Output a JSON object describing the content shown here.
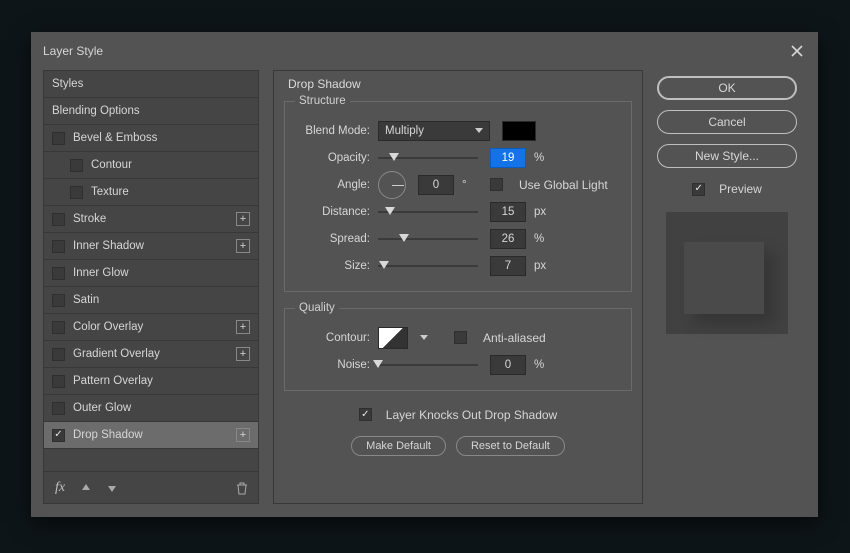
{
  "dialog": {
    "title": "Layer Style"
  },
  "styles": [
    {
      "label": "Styles",
      "type": "head"
    },
    {
      "label": "Blending Options",
      "type": "head"
    },
    {
      "label": "Bevel & Emboss",
      "chk": 1
    },
    {
      "label": "Contour",
      "chk": 1,
      "indent": 1
    },
    {
      "label": "Texture",
      "chk": 1,
      "indent": 1
    },
    {
      "label": "Stroke",
      "chk": 1,
      "plus": 1
    },
    {
      "label": "Inner Shadow",
      "chk": 1,
      "plus": 1
    },
    {
      "label": "Inner Glow",
      "chk": 1
    },
    {
      "label": "Satin",
      "chk": 1
    },
    {
      "label": "Color Overlay",
      "chk": 1,
      "plus": 1
    },
    {
      "label": "Gradient Overlay",
      "chk": 1,
      "plus": 1
    },
    {
      "label": "Pattern Overlay",
      "chk": 1
    },
    {
      "label": "Outer Glow",
      "chk": 1
    },
    {
      "label": "Drop Shadow",
      "chk": 1,
      "checked": 1,
      "active": 1,
      "plus": 1
    }
  ],
  "panel": {
    "heading": "Drop Shadow",
    "group_structure": "Structure",
    "group_quality": "Quality",
    "blend_label": "Blend Mode:",
    "blend_value": "Multiply",
    "opacity_label": "Opacity:",
    "opacity_value": "19",
    "opacity_unit": "%",
    "opacity_pos": "16%",
    "angle_label": "Angle:",
    "angle_value": "0",
    "angle_unit": "°",
    "use_global_label": "Use Global Light",
    "distance_label": "Distance:",
    "distance_value": "15",
    "distance_unit": "px",
    "distance_pos": "12%",
    "spread_label": "Spread:",
    "spread_value": "26",
    "spread_unit": "%",
    "spread_pos": "26%",
    "size_label": "Size:",
    "size_value": "7",
    "size_unit": "px",
    "size_pos": "6%",
    "contour_label": "Contour:",
    "antialiased_label": "Anti-aliased",
    "noise_label": "Noise:",
    "noise_value": "0",
    "noise_unit": "%",
    "noise_pos": "0%",
    "knockout_label": "Layer Knocks Out Drop Shadow",
    "make_default": "Make Default",
    "reset_default": "Reset to Default"
  },
  "right": {
    "ok": "OK",
    "cancel": "Cancel",
    "new_style": "New Style...",
    "preview": "Preview"
  }
}
